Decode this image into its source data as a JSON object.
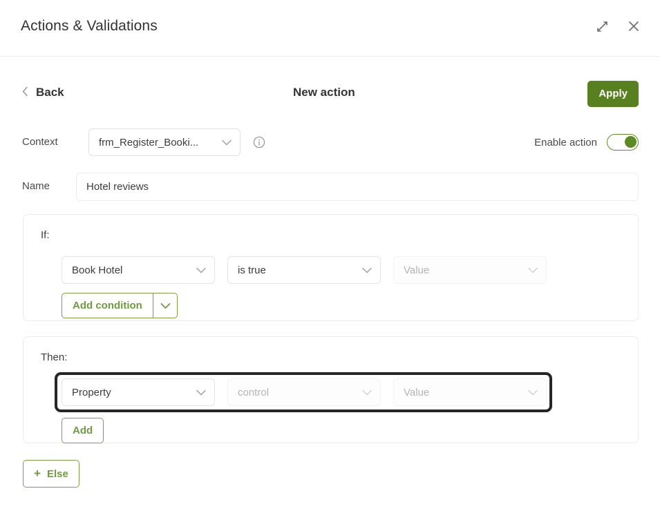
{
  "window": {
    "title": "Actions & Validations",
    "expand_icon": "expand-diagonal-icon",
    "close_icon": "close-icon"
  },
  "subheader": {
    "back_label": "Back",
    "back_chevron": "chevron-left-icon",
    "title": "New action",
    "apply_label": "Apply"
  },
  "context": {
    "label": "Context",
    "selected": "frm_Register_Booki...",
    "info_icon": "info-icon",
    "enable_label": "Enable action",
    "enable_state": "on"
  },
  "name": {
    "label": "Name",
    "value": "Hotel reviews",
    "placeholder": "Name"
  },
  "if_panel": {
    "caption": "If:",
    "selects": [
      {
        "value": "Book Hotel",
        "placeholder": "",
        "disabled": false
      },
      {
        "value": "is true",
        "placeholder": "",
        "disabled": false
      },
      {
        "value": "",
        "placeholder": "Value",
        "disabled": true
      }
    ],
    "add_condition_label": "Add condition"
  },
  "then_panel": {
    "caption": "Then:",
    "focused": true,
    "selects": [
      {
        "value": "Property",
        "placeholder": "",
        "disabled": false
      },
      {
        "value": "",
        "placeholder": "control",
        "disabled": true
      },
      {
        "value": "",
        "placeholder": "Value",
        "disabled": true
      }
    ],
    "add_label": "Add"
  },
  "else_button": {
    "label": "Else",
    "plus": "+"
  },
  "colors": {
    "accent_green": "#57811f",
    "outline_green": "#7ba046",
    "text_green": "#6f9b3f",
    "toggle_green": "#5d8a24",
    "focus_ring": "#262626",
    "border_light": "#ececec"
  }
}
